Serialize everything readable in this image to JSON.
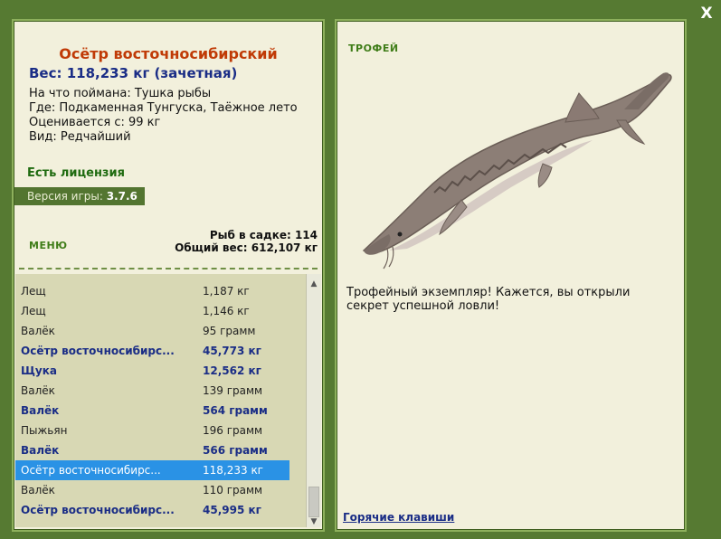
{
  "close": {
    "label": "X"
  },
  "catch": {
    "name": "Осётр восточносибирский",
    "weight": "Вес: 118,233 кг (зачетная)",
    "bait": "На что поймана: Тушка рыбы",
    "location": "Где: Подкаменная Тунгуска, Таёжное лето",
    "value": "Оценивается с: 99 кг",
    "rarity": "Вид: Редчайший"
  },
  "license": "Есть лицензия",
  "version": {
    "label": "Версия игры:",
    "value": "3.7.6"
  },
  "menu": {
    "label": "МЕНЮ"
  },
  "stats": {
    "fish_count": "Рыб в садке: 114",
    "total_weight": "Общий вес: 612,107 кг"
  },
  "fish_list": [
    {
      "name": "Лещ",
      "weight": "1,187 кг",
      "style": "plain"
    },
    {
      "name": "Лещ",
      "weight": "1,146 кг",
      "style": "plain"
    },
    {
      "name": "Валёк",
      "weight": "95 грамм",
      "style": "plain"
    },
    {
      "name": "Осётр восточносибирс...",
      "weight": "45,773 кг",
      "style": "trophy"
    },
    {
      "name": "Щука",
      "weight": "12,562 кг",
      "style": "trophy"
    },
    {
      "name": "Валёк",
      "weight": "139 грамм",
      "style": "plain"
    },
    {
      "name": "Валёк",
      "weight": "564 грамм",
      "style": "trophy"
    },
    {
      "name": "Пыжьян",
      "weight": "196 грамм",
      "style": "plain"
    },
    {
      "name": "Валёк",
      "weight": "566 грамм",
      "style": "trophy"
    },
    {
      "name": "Осётр восточносибирс...",
      "weight": "118,233 кг",
      "style": "sel"
    },
    {
      "name": "Валёк",
      "weight": "110 грамм",
      "style": "plain"
    },
    {
      "name": "Осётр восточносибирс...",
      "weight": "45,995 кг",
      "style": "trophy"
    }
  ],
  "scroll": {
    "up_icon": "arrow-up-icon",
    "down_icon": "arrow-down-icon"
  },
  "trophy": {
    "label": "ТРОФЕЙ",
    "description": "Трофейный экземпляр! Кажется, вы открыли секрет успешной ловли!"
  },
  "hotkeys": {
    "label": "Горячие клавиши"
  }
}
